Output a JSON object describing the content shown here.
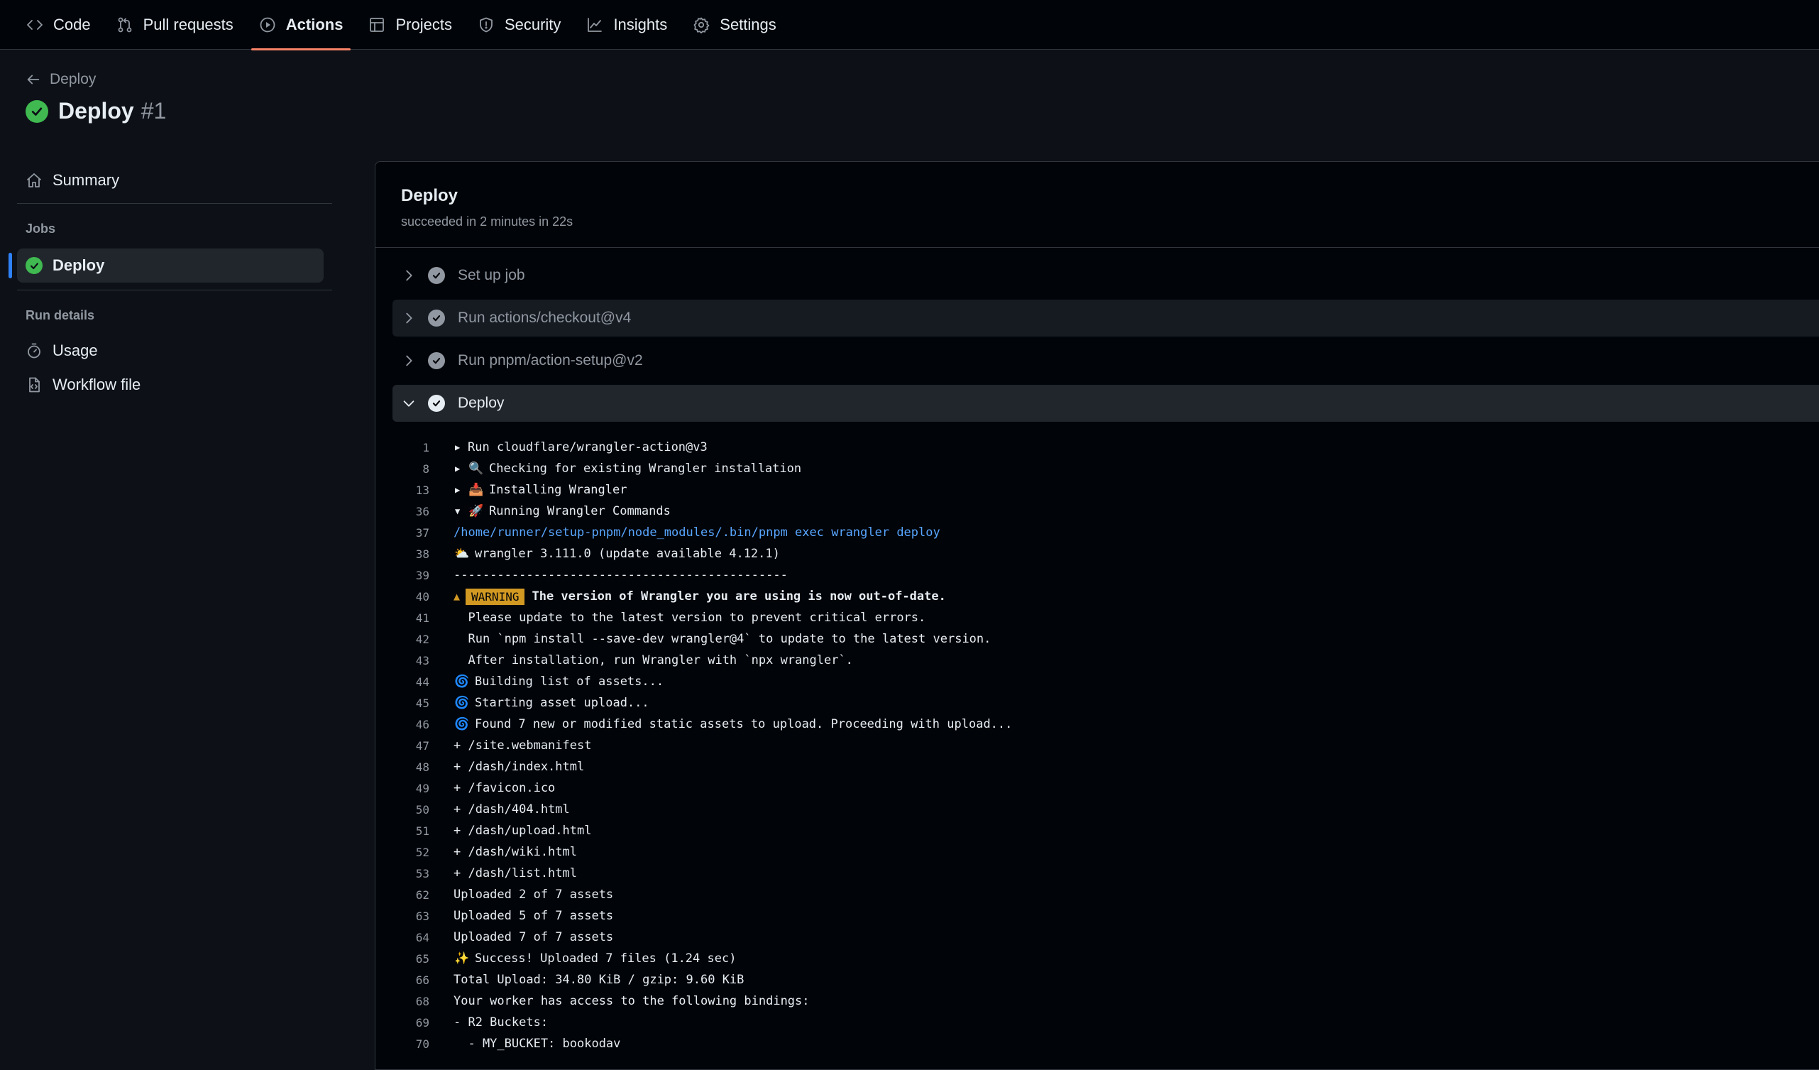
{
  "nav": {
    "tabs": [
      {
        "label": "Code",
        "icon": "code-icon"
      },
      {
        "label": "Pull requests",
        "icon": "pull-request-icon"
      },
      {
        "label": "Actions",
        "icon": "play-circle-icon",
        "active": true
      },
      {
        "label": "Projects",
        "icon": "table-icon"
      },
      {
        "label": "Security",
        "icon": "shield-icon"
      },
      {
        "label": "Insights",
        "icon": "graph-icon"
      },
      {
        "label": "Settings",
        "icon": "gear-icon"
      }
    ]
  },
  "header": {
    "back_label": "Deploy",
    "title": "Deploy",
    "run_number": "#1",
    "status": "success"
  },
  "sidebar": {
    "summary_label": "Summary",
    "jobs_heading": "Jobs",
    "job_label": "Deploy",
    "run_details_heading": "Run details",
    "usage_label": "Usage",
    "workflow_file_label": "Workflow file"
  },
  "job": {
    "title": "Deploy",
    "subtitle": "succeeded in 2 minutes in 22s",
    "steps": [
      {
        "label": "Set up job",
        "expanded": false
      },
      {
        "label": "Run actions/checkout@v4",
        "expanded": false
      },
      {
        "label": "Run pnpm/action-setup@v2",
        "expanded": false
      },
      {
        "label": "Deploy",
        "expanded": true
      }
    ]
  },
  "log": {
    "lines": [
      {
        "n": "1",
        "text": "Run cloudflare/wrangler-action@v3",
        "group": "collapsed"
      },
      {
        "n": "8",
        "text": "Checking for existing Wrangler installation",
        "group": "collapsed",
        "emoji": "🔍"
      },
      {
        "n": "13",
        "text": "Installing Wrangler",
        "group": "collapsed",
        "emoji": "📥"
      },
      {
        "n": "36",
        "text": "Running Wrangler Commands",
        "group": "expanded",
        "emoji": "🚀"
      },
      {
        "n": "37",
        "text": "/home/runner/setup-pnpm/node_modules/.bin/pnpm exec wrangler deploy",
        "style": "cmd"
      },
      {
        "n": "38",
        "text": "wrangler 3.111.0 (update available 4.12.1)",
        "emoji": "⛅"
      },
      {
        "n": "39",
        "text": "----------------------------------------------"
      },
      {
        "n": "40",
        "text": "The version of Wrangler you are using is now out-of-date.",
        "style": "warning",
        "warning_label": "WARNING",
        "warning_glyph": "▲"
      },
      {
        "n": "41",
        "text": "  Please update to the latest version to prevent critical errors."
      },
      {
        "n": "42",
        "text": "  Run `npm install --save-dev wrangler@4` to update to the latest version."
      },
      {
        "n": "43",
        "text": "  After installation, run Wrangler with `npx wrangler`."
      },
      {
        "n": "44",
        "text": "Building list of assets...",
        "emoji": "🌀"
      },
      {
        "n": "45",
        "text": "Starting asset upload...",
        "emoji": "🌀"
      },
      {
        "n": "46",
        "text": "Found 7 new or modified static assets to upload. Proceeding with upload...",
        "emoji": "🌀"
      },
      {
        "n": "47",
        "text": "+ /site.webmanifest"
      },
      {
        "n": "48",
        "text": "+ /dash/index.html"
      },
      {
        "n": "49",
        "text": "+ /favicon.ico"
      },
      {
        "n": "50",
        "text": "+ /dash/404.html"
      },
      {
        "n": "51",
        "text": "+ /dash/upload.html"
      },
      {
        "n": "52",
        "text": "+ /dash/wiki.html"
      },
      {
        "n": "53",
        "text": "+ /dash/list.html"
      },
      {
        "n": "62",
        "text": "Uploaded 2 of 7 assets"
      },
      {
        "n": "63",
        "text": "Uploaded 5 of 7 assets"
      },
      {
        "n": "64",
        "text": "Uploaded 7 of 7 assets"
      },
      {
        "n": "65",
        "text": "Success! Uploaded 7 files (1.24 sec)",
        "emoji": "✨"
      },
      {
        "n": "66",
        "text": "Total Upload: 34.80 KiB / gzip: 9.60 KiB"
      },
      {
        "n": "68",
        "text": "Your worker has access to the following bindings:"
      },
      {
        "n": "69",
        "text": "- R2 Buckets:"
      },
      {
        "n": "70",
        "text": "  - MY_BUCKET: bookodav"
      }
    ]
  },
  "colors": {
    "success": "#3fb950",
    "active_tab_underline": "#f78166",
    "selected_job_bar": "#2f81f7",
    "warning": "#d29922",
    "command": "#58a6ff"
  }
}
